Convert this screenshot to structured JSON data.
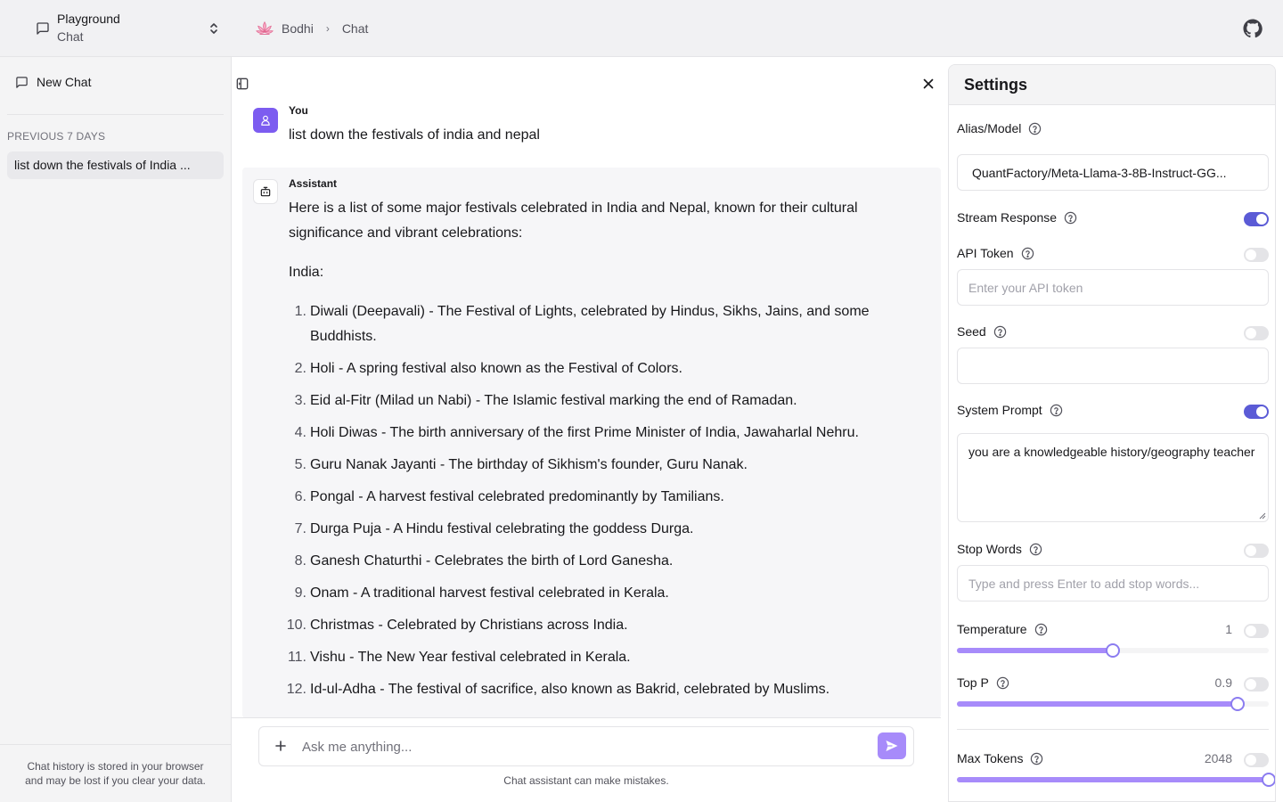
{
  "header": {
    "app_title": "Playground",
    "app_subtitle": "Chat",
    "breadcrumb_root": "Bodhi",
    "breadcrumb_current": "Chat",
    "breadcrumb_sep": "›"
  },
  "sidebar": {
    "new_chat": "New Chat",
    "section_label": "PREVIOUS 7 DAYS",
    "history": [
      "list down the festivals of India ..."
    ],
    "footer_line1": "Chat history is stored in your browser",
    "footer_line2": "and may be lost if you clear your data."
  },
  "chat": {
    "user_role": "You",
    "user_message": "list down the festivals of india and nepal",
    "assistant_role": "Assistant",
    "assistant_intro": "Here is a list of some major festivals celebrated in India and Nepal, known for their cultural significance and vibrant celebrations:",
    "assistant_subheading": "India:",
    "items": [
      {
        "num": "1.",
        "text": "Diwali (Deepavali) - The Festival of Lights, celebrated by Hindus, Sikhs, Jains, and some Buddhists."
      },
      {
        "num": "2.",
        "text": "Holi - A spring festival also known as the Festival of Colors."
      },
      {
        "num": "3.",
        "text": "Eid al-Fitr (Milad un Nabi) - The Islamic festival marking the end of Ramadan."
      },
      {
        "num": "4.",
        "text": "Holi Diwas - The birth anniversary of the first Prime Minister of India, Jawaharlal Nehru."
      },
      {
        "num": "5.",
        "text": "Guru Nanak Jayanti - The birthday of Sikhism's founder, Guru Nanak."
      },
      {
        "num": "6.",
        "text": "Pongal - A harvest festival celebrated predominantly by Tamilians."
      },
      {
        "num": "7.",
        "text": "Durga Puja - A Hindu festival celebrating the goddess Durga."
      },
      {
        "num": "8.",
        "text": "Ganesh Chaturthi - Celebrates the birth of Lord Ganesha."
      },
      {
        "num": "9.",
        "text": "Onam - A traditional harvest festival celebrated in Kerala."
      },
      {
        "num": "10.",
        "text": "Christmas - Celebrated by Christians across India."
      },
      {
        "num": "11.",
        "text": "Vishu - The New Year festival celebrated in Kerala."
      },
      {
        "num": "12.",
        "text": "Id-ul-Adha - The festival of sacrifice, also known as Bakrid, celebrated by Muslims."
      }
    ],
    "input_placeholder": "Ask me anything...",
    "disclaimer": "Chat assistant can make mistakes."
  },
  "settings": {
    "title": "Settings",
    "alias_label": "Alias/Model",
    "alias_value": "QuantFactory/Meta-Llama-3-8B-Instruct-GG...",
    "stream_label": "Stream Response",
    "stream_on": true,
    "api_token_label": "API Token",
    "api_token_on": false,
    "api_token_placeholder": "Enter your API token",
    "seed_label": "Seed",
    "seed_on": false,
    "seed_value": "",
    "system_prompt_label": "System Prompt",
    "system_prompt_on": true,
    "system_prompt_value": "you are a knowledgeable history/geography teacher",
    "stop_words_label": "Stop Words",
    "stop_words_on": false,
    "stop_words_placeholder": "Type and press Enter to add stop words...",
    "temperature_label": "Temperature",
    "temperature_value": "1",
    "temperature_fraction": 0.5,
    "temperature_on": false,
    "top_p_label": "Top P",
    "top_p_value": "0.9",
    "top_p_fraction": 0.9,
    "top_p_on": false,
    "max_tokens_label": "Max Tokens",
    "max_tokens_value": "2048",
    "max_tokens_fraction": 1.0,
    "max_tokens_on": false
  },
  "colors": {
    "accent": "#5b5bd6",
    "slider_fill": "#a78bfa",
    "user_avatar": "#7c5cf0"
  }
}
